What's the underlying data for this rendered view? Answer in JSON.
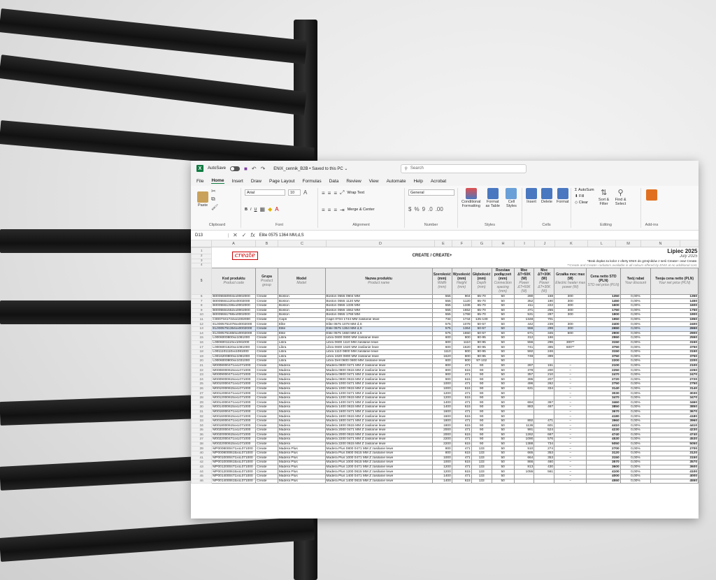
{
  "excel": {
    "autosave_label": "AutoSave",
    "file_title": "ENIX_cennik_B2B • Saved to this PC ⌄",
    "search_placeholder": "Search",
    "menu": [
      "File",
      "Home",
      "Insert",
      "Draw",
      "Page Layout",
      "Formulas",
      "Data",
      "Review",
      "View",
      "Automate",
      "Help",
      "Acrobat"
    ],
    "ribbon": {
      "paste": "Paste",
      "clipboard": "Clipboard",
      "font_name": "Arial",
      "font_size": "10",
      "font": "Font",
      "wrap_text": "Wrap Text",
      "merge_center": "Merge & Center",
      "alignment": "Alignment",
      "number_format": "General",
      "number": "Number",
      "conditional": "Conditional Formatting",
      "format_table": "Format as Table",
      "cell_styles": "Cell Styles",
      "styles": "Styles",
      "insert": "Insert",
      "delete": "Delete",
      "format": "Format",
      "cells": "Cells",
      "autosum": "AutoSum",
      "fill": "Fill",
      "clear": "Clear",
      "sort_filter": "Sort & Filter",
      "find_select": "Find & Select",
      "editing": "Editing",
      "addins": "Add-ins"
    },
    "namebox": "D13",
    "formula": "Elite 0575 1364 MM,d,S"
  },
  "sheet": {
    "col_letters": [
      "A",
      "B",
      "C",
      "D",
      "E",
      "F",
      "G",
      "H",
      "I",
      "J",
      "K",
      "L",
      "M",
      "N"
    ],
    "logo_text": "create",
    "title": "CREATE / CREATE+",
    "month": "Lipiec 2025",
    "month_en": "July 2025",
    "note1": "*Brak dopłat za kolor z oferty ENIX do grzejników z serii Create+ oraz Create.",
    "note2": "**Create and Create+ radiators available in all colours offered by ENIX at no additional cost.",
    "headers": [
      [
        "Kod produktu",
        "Product code"
      ],
      [
        "Grupa",
        "Product group"
      ],
      [
        "Model",
        "Model"
      ],
      [
        "Nazwa produktu",
        "Product name"
      ],
      [
        "Szerokość (mm)",
        "Width (mm)"
      ],
      [
        "Wysokość (mm)",
        "Height (mm)"
      ],
      [
        "Głębokość (mm)",
        "Depth (mm)"
      ],
      [
        "Rozstaw podłączeń (mm)",
        "Connection spacing (mm)"
      ],
      [
        "Moc ΔT=50K (W)",
        "Power ΔT=50K (W)"
      ],
      [
        "Moc ΔT=30K (W)",
        "Power ΔT=30K (W)"
      ],
      [
        "Grzałka moc max (W)",
        "Electric heater max power (W)"
      ],
      [
        "Cena netto STD (PLN)",
        "STD net price (PLN)"
      ],
      [
        "Twój rabat",
        "Your discount"
      ],
      [
        "Twoja cena netto (PLN)",
        "Your net price (PLN)"
      ]
    ],
    "rows": [
      [
        "6",
        "B0005550904xx0002000",
        "Create",
        "Boston",
        "Boston 0555 0904 MM",
        "555",
        "904",
        "65-70",
        "50",
        "280",
        "158",
        "300",
        "1350",
        "0,00%",
        "1350"
      ],
      [
        "7",
        "B0005551120xx0002000",
        "Create",
        "Boston",
        "Boston 0555 1120 MM",
        "555",
        "1120",
        "65-70",
        "50",
        "352",
        "190",
        "300",
        "1450",
        "0,00%",
        "1450"
      ],
      [
        "8",
        "B0005551336xx0002000",
        "Create",
        "Boston",
        "Boston 0555 1336 MM",
        "555",
        "1336",
        "65-70",
        "50",
        "411",
        "222",
        "300",
        "1600",
        "0,00%",
        "1600"
      ],
      [
        "9",
        "B0005551552xx0002000",
        "Create",
        "Boston",
        "Boston 0555 1552 MM",
        "555",
        "1552",
        "65-70",
        "50",
        "471",
        "255",
        "300",
        "1750",
        "0,00%",
        "1750"
      ],
      [
        "10",
        "B0005551768xx0002000",
        "Create",
        "Boston",
        "Boston 0555 1768 MM",
        "555",
        "1768",
        "65-70",
        "50",
        "531",
        "287",
        "300",
        "1900",
        "0,00%",
        "1900"
      ],
      [
        "11",
        "C0007341744xx1002000",
        "Create",
        "Capri",
        "Capri 0734 1744 MM zasilanie lewe",
        "734",
        "1744",
        "125-130",
        "50",
        "1348",
        "701",
        "",
        "1950",
        "0,00%",
        "1950"
      ],
      [
        "12",
        "EL0005751078xx0002000",
        "Create",
        "Elite",
        "Elite 0575 1078 MM d,S",
        "575",
        "1078",
        "50-57",
        "50",
        "442",
        "239",
        "300",
        "2400",
        "0,00%",
        "2400"
      ],
      [
        "13",
        "EL0005751364xx0002000",
        "Create",
        "Elite",
        "Elite 0575 1364 MM d,S",
        "575",
        "1364",
        "50-57",
        "50",
        "556",
        "299",
        "300",
        "2650",
        "0,00%",
        "2650"
      ],
      [
        "14",
        "EL0005751650xx0002000",
        "Create",
        "Elite",
        "Elite 0575 1650 MM d,S",
        "575",
        "1650",
        "50-57",
        "50",
        "671",
        "345",
        "600",
        "2900",
        "0,00%",
        "2900"
      ],
      [
        "15",
        "L0006000800xx1081000",
        "Create",
        "Libra",
        "Libra 0600 0800 MM zasilanie lewe",
        "600",
        "800",
        "90-95",
        "50",
        "312",
        "166",
        "",
        "2550",
        "0,00%",
        "2550"
      ],
      [
        "16",
        "L0006001110xx1081000",
        "Create",
        "Libra",
        "Libra 0600 1110 MM zasilanie lewe",
        "600",
        "1110",
        "90-95",
        "50",
        "556",
        "296",
        "300**",
        "3150",
        "0,00%",
        "3150"
      ],
      [
        "17",
        "L0006001620xx1081000",
        "Create",
        "Libra",
        "Libra 0600 1620 MM zasilanie lewe",
        "600",
        "1620",
        "90-95",
        "50",
        "741",
        "395",
        "600**",
        "3750",
        "0,00%",
        "3750"
      ],
      [
        "18",
        "L0011101110xx1081000",
        "Create",
        "Libra",
        "Libra 1110 0800 MM zasilanie lewe",
        "1110",
        "800",
        "90-95",
        "50",
        "592",
        "246",
        "",
        "3150",
        "0,00%",
        "3150"
      ],
      [
        "19",
        "L0016200800xx1081000",
        "Create",
        "Libra",
        "Libra 1620 0800 MM zasilanie lewe",
        "1620",
        "800",
        "90-95",
        "50",
        "749",
        "399",
        "",
        "3750",
        "0,00%",
        "3750"
      ],
      [
        "20",
        "L0006000800xx1031000",
        "Create",
        "Libra",
        "Libra Dell 0600 0800 MM zasilanie lewe",
        "600",
        "800",
        "97-102",
        "50",
        "",
        "",
        "",
        "2200",
        "0,00%",
        "2200"
      ],
      [
        "21",
        "M0008000471xxL071000",
        "Create",
        "Madera",
        "Madera 0800 0471 MM Z zasilanie lewe",
        "800",
        "471",
        "90",
        "50",
        "287",
        "151",
        "–",
        "2100",
        "0,00%",
        "2100"
      ],
      [
        "22",
        "M0008000615xxL071000",
        "Create",
        "Madera",
        "Madera 0800 0615 MM Z zasilanie lewe",
        "800",
        "615",
        "90",
        "50",
        "378",
        "200",
        "–",
        "2250",
        "0,00%",
        "2250"
      ],
      [
        "23",
        "M0009000471xxL071000",
        "Create",
        "Madera",
        "Madera 0900 0471 MM Z zasilanie lewe",
        "900",
        "471",
        "90",
        "50",
        "357",
        "210",
        "–",
        "2470",
        "0,00%",
        "2470"
      ],
      [
        "24",
        "M0009000615xxL071000",
        "Create",
        "Madera",
        "Madera 0900 0615 MM Z zasilanie lewe",
        "900",
        "615",
        "90",
        "50",
        "395",
        "207",
        "–",
        "2720",
        "0,00%",
        "2720"
      ],
      [
        "25",
        "M0010000471xxL071000",
        "Create",
        "Madera",
        "Madera 1000 0471 MM Z zasilanie lewe",
        "1000",
        "471",
        "90",
        "50",
        "496",
        "262",
        "–",
        "2750",
        "0,00%",
        "2750"
      ],
      [
        "26",
        "M0010000615xxL071000",
        "Create",
        "Madera",
        "Madera 1000 0615 MM Z zasilanie lewe",
        "1000",
        "615",
        "90",
        "50",
        "631",
        "334",
        "–",
        "3140",
        "0,00%",
        "3140"
      ],
      [
        "27",
        "M0012000471xxL071000",
        "Create",
        "Madera",
        "Madera 1200 0471 MM Z zasilanie lewe",
        "1200",
        "471",
        "90",
        "50",
        "",
        "",
        "–",
        "3030",
        "0,00%",
        "3030"
      ],
      [
        "28",
        "M0012000615xxL071000",
        "Create",
        "Madera",
        "Madera 1200 0615 MM Z zasilanie lewe",
        "1200",
        "615",
        "90",
        "50",
        "",
        "",
        "–",
        "3470",
        "0,00%",
        "3470"
      ],
      [
        "29",
        "M0014000471xxL071000",
        "Create",
        "Madera",
        "Madera 1400 0471 MM Z zasilanie lewe",
        "1400",
        "471",
        "90",
        "50",
        "694",
        "367",
        "–",
        "3460",
        "0,00%",
        "3460"
      ],
      [
        "30",
        "M0014000615xxL071000",
        "Create",
        "Madera",
        "Madera 1400 0615 MM Z zasilanie lewe",
        "1400",
        "615",
        "90",
        "50",
        "883",
        "467",
        "–",
        "3850",
        "0,00%",
        "3850"
      ],
      [
        "31",
        "M0016000471xxL071000",
        "Create",
        "Madera",
        "Madera 1600 0471 MM Z zasilanie lewe",
        "1600",
        "471",
        "90",
        "50",
        "",
        "",
        "–",
        "3670",
        "0,00%",
        "3670"
      ],
      [
        "32",
        "M0016000615xxL071000",
        "Create",
        "Madera",
        "Madera 1600 0615 MM Z zasilanie lewe",
        "1600",
        "615",
        "90",
        "50",
        "",
        "",
        "–",
        "4180",
        "0,00%",
        "4180"
      ],
      [
        "33",
        "M0018000471xxL071000",
        "Create",
        "Madera",
        "Madera 1800 0471 MM Z zasilanie lewe",
        "1800",
        "471",
        "90",
        "50",
        "892",
        "471",
        "–",
        "3960",
        "0,00%",
        "3960"
      ],
      [
        "34",
        "M0018000615xxL071000",
        "Create",
        "Madera",
        "Madera 1800 0615 MM Z zasilanie lewe",
        "1800",
        "615",
        "90",
        "50",
        "1136",
        "601",
        "–",
        "4410",
        "0,00%",
        "4410"
      ],
      [
        "35",
        "M0020000471xxL071000",
        "Create",
        "Madera",
        "Madera 2000 0471 MM Z zasilanie lewe",
        "2000",
        "471",
        "90",
        "50",
        "991",
        "524",
        "–",
        "4230",
        "0,00%",
        "4230"
      ],
      [
        "36",
        "M0020000615xxL071000",
        "Create",
        "Madera",
        "Madera 2000 0615 MM Z zasilanie lewe",
        "2000",
        "615",
        "90",
        "50",
        "1262",
        "667",
        "–",
        "4740",
        "0,00%",
        "4740"
      ],
      [
        "37",
        "M0022000471xxL071000",
        "Create",
        "Madera",
        "Madera 2200 0471 MM Z zasilanie lewe",
        "2200",
        "471",
        "90",
        "50",
        "1090",
        "576",
        "–",
        "4530",
        "0,00%",
        "4530"
      ],
      [
        "38",
        "M0022000615xxL071000",
        "Create",
        "Madera",
        "Madera 2200 0615 MM Z zasilanie lewe",
        "2200",
        "615",
        "90",
        "50",
        "1388",
        "734",
        "–",
        "5050",
        "0,00%",
        "5050"
      ],
      [
        "39",
        "MP0008000471xxL071000",
        "Create",
        "Madera Plus",
        "Madera Plus 0800 0471 MM Z zasilanie lewe",
        "800",
        "471",
        "133",
        "50",
        "510",
        "274",
        "–",
        "2700",
        "0,00%",
        "2700"
      ],
      [
        "40",
        "MP0008000615xxL071000",
        "Create",
        "Madera Plus",
        "Madera Plus 0800 0615 MM Z zasilanie lewe",
        "800",
        "615",
        "133",
        "50",
        "665",
        "353",
        "–",
        "3120",
        "0,00%",
        "3120"
      ],
      [
        "41",
        "MP0010000471xxL071000",
        "Create",
        "Madera Plus",
        "Madera Plus 1000 0471 MM Z zasilanie lewe",
        "1000",
        "471",
        "133",
        "50",
        "664",
        "353",
        "–",
        "3150",
        "0,00%",
        "3150"
      ],
      [
        "42",
        "MP0010000615xxL071000",
        "Create",
        "Madera Plus",
        "Madera Plus 1000 0615 MM Z zasilanie lewe",
        "1000",
        "615",
        "133",
        "50",
        "866",
        "460",
        "–",
        "3570",
        "0,00%",
        "3570"
      ],
      [
        "43",
        "MP0012000471xxL071000",
        "Create",
        "Madera Plus",
        "Madera Plus 1200 0471 MM Z zasilanie lewe",
        "1200",
        "471",
        "133",
        "50",
        "813",
        "430",
        "–",
        "3600",
        "0,00%",
        "3600"
      ],
      [
        "44",
        "MP0012000615xxL071000",
        "Create",
        "Madera Plus",
        "Madera Plus 1200 0615 MM Z zasilanie lewe",
        "1200",
        "615",
        "133",
        "50",
        "1055",
        "561",
        "–",
        "4100",
        "0,00%",
        "4100"
      ],
      [
        "45",
        "MP0014000471xxL071000",
        "Create",
        "Madera Plus",
        "Madera Plus 1400 0471 MM Z zasilanie lewe",
        "1400",
        "471",
        "133",
        "50",
        "",
        "",
        "–",
        "4000",
        "0,00%",
        "4000"
      ],
      [
        "46",
        "MP0014000615xxL071000",
        "Create",
        "Madera Plus",
        "Madera Plus 1400 0615 MM Z zasilanie lewe",
        "1400",
        "615",
        "133",
        "50",
        "",
        "",
        "–",
        "4550",
        "0,00%",
        "4550"
      ]
    ]
  }
}
